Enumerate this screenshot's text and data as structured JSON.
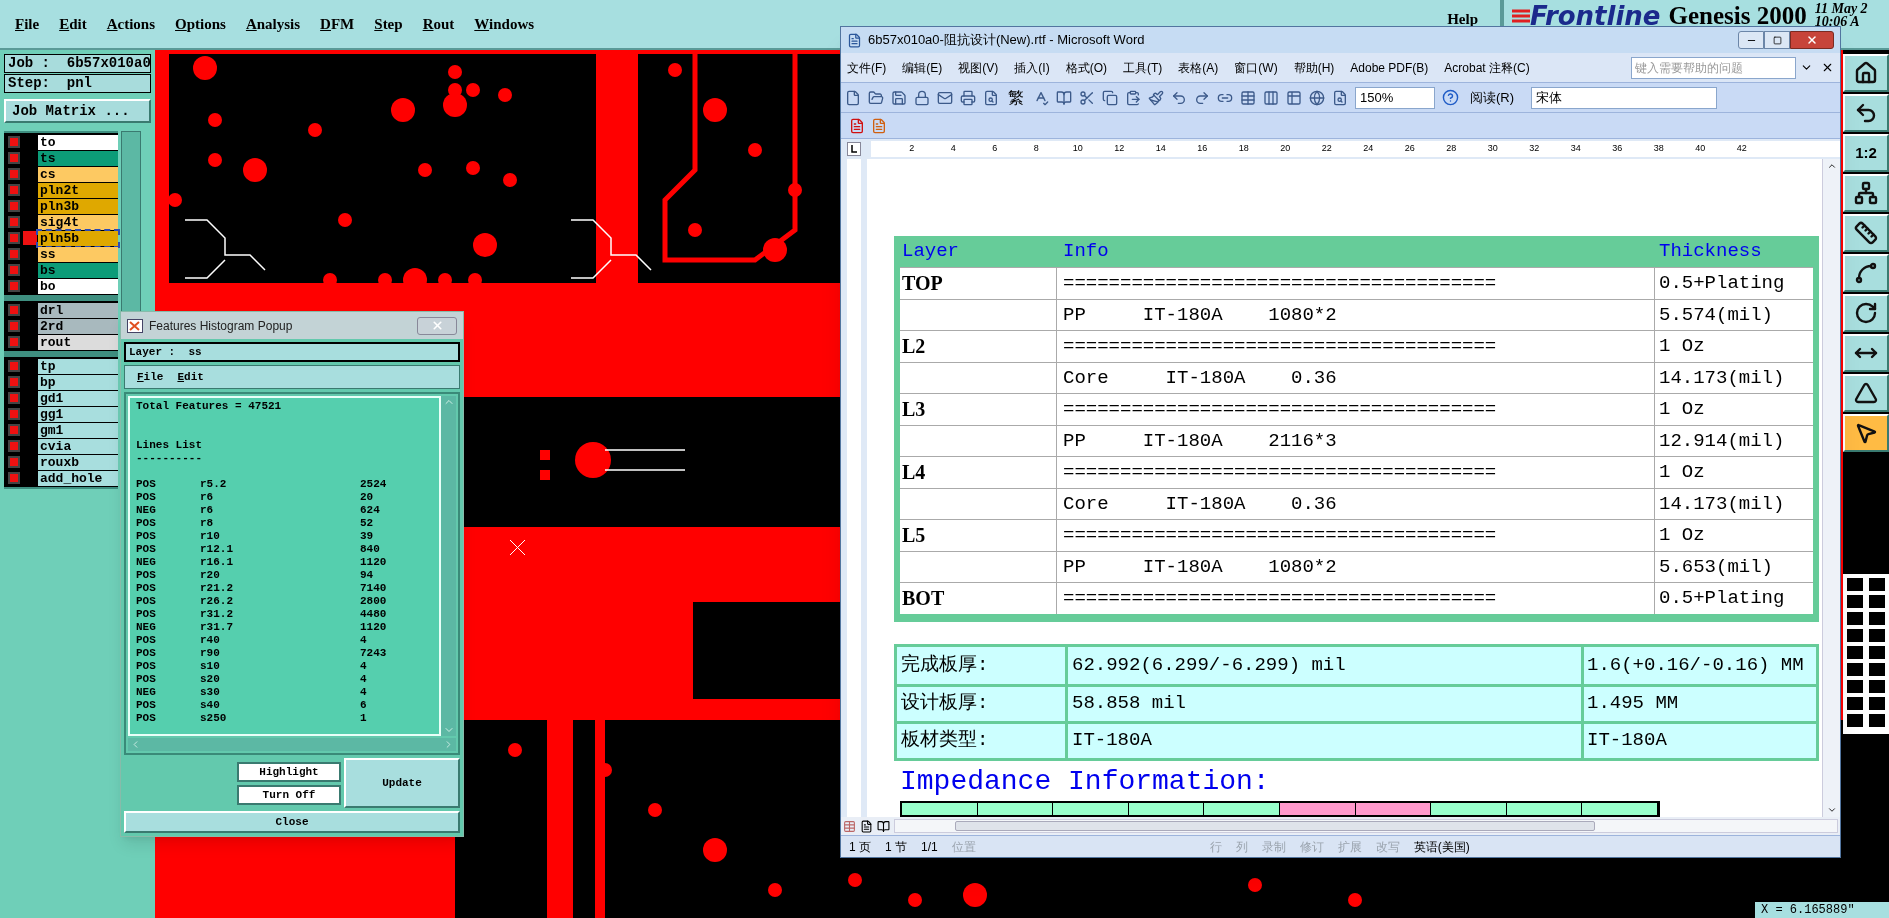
{
  "menu_bar": {
    "items": [
      "File",
      "Edit",
      "Actions",
      "Options",
      "Analysis",
      "DFM",
      "Step",
      "Rout",
      "Windows"
    ],
    "help": "Help"
  },
  "brand": {
    "logo": "Frontline",
    "product": "Genesis 2000",
    "date": "11 May 2",
    "time": "10:06 A"
  },
  "job": {
    "job": "Job :  6b57x010a0",
    "step": "Step:  pnl",
    "matrix_button": "Job Matrix ..."
  },
  "layer_groups": [
    [
      {
        "name": "to",
        "color": "#ffffff",
        "checked": true,
        "selected": false
      },
      {
        "name": "ts",
        "color": "#0c9c78",
        "checked": true,
        "selected": false
      },
      {
        "name": "cs",
        "color": "#fdc962",
        "checked": true,
        "selected": false
      },
      {
        "name": "pln2t",
        "color": "#dfa800",
        "checked": true,
        "selected": false
      },
      {
        "name": "pln3b",
        "color": "#dfa800",
        "checked": true,
        "selected": false
      },
      {
        "name": "sig4t",
        "color": "#fdc962",
        "checked": true,
        "selected": false
      },
      {
        "name": "pln5b",
        "color": "#dfa800",
        "checked": true,
        "selected": true
      },
      {
        "name": "ss",
        "color": "#fdc962",
        "checked": true,
        "selected": false
      },
      {
        "name": "bs",
        "color": "#0c9c78",
        "checked": true,
        "selected": false
      },
      {
        "name": "bo",
        "color": "#ffffff",
        "checked": true,
        "selected": false
      }
    ],
    [
      {
        "name": "drl",
        "color": "#a8b9be",
        "checked": true,
        "selected": false
      },
      {
        "name": "2rd",
        "color": "#a8b9be",
        "checked": true,
        "selected": false
      },
      {
        "name": "rout",
        "color": "#dcdcdc",
        "checked": true,
        "selected": false
      }
    ],
    [
      {
        "name": "tp",
        "color": "#a8dede",
        "checked": true,
        "selected": false
      },
      {
        "name": "bp",
        "color": "#a8dede",
        "checked": true,
        "selected": false
      },
      {
        "name": "gd1",
        "color": "#a8dede",
        "checked": true,
        "selected": false
      },
      {
        "name": "gg1",
        "color": "#a8dede",
        "checked": true,
        "selected": false
      },
      {
        "name": "gm1",
        "color": "#a8dede",
        "checked": true,
        "selected": false
      },
      {
        "name": "cvia",
        "color": "#a8dede",
        "checked": true,
        "selected": false
      },
      {
        "name": "rouxb",
        "color": "#a8dede",
        "checked": true,
        "selected": false
      },
      {
        "name": "add_hole",
        "color": "#a8dede",
        "checked": true,
        "selected": false
      }
    ]
  ],
  "tool_buttons": [
    {
      "kind": "home",
      "selected": false
    },
    {
      "kind": "undo",
      "selected": false
    },
    {
      "kind": "text",
      "label": "1:2",
      "selected": false
    },
    {
      "kind": "network",
      "selected": false
    },
    {
      "kind": "ruler",
      "selected": false
    },
    {
      "kind": "line",
      "selected": false
    },
    {
      "kind": "rotate",
      "selected": false
    },
    {
      "kind": "arrows",
      "selected": false
    },
    {
      "kind": "triangle",
      "selected": false
    },
    {
      "kind": "pointer",
      "selected": true
    }
  ],
  "coordinates": "X = 6.165889\"",
  "histogram": {
    "title": "Features Histogram Popup",
    "layer": "Layer :  ss",
    "menu": [
      "File",
      "Edit"
    ],
    "total": "Total Features = 47521",
    "list_title": "Lines List",
    "separator": "----------",
    "rows": [
      {
        "polarity": "POS",
        "symbol": "r5.2",
        "count": "2524"
      },
      {
        "polarity": "POS",
        "symbol": "r6",
        "count": "20"
      },
      {
        "polarity": "NEG",
        "symbol": "r6",
        "count": "624"
      },
      {
        "polarity": "POS",
        "symbol": "r8",
        "count": "52"
      },
      {
        "polarity": "POS",
        "symbol": "r10",
        "count": "39"
      },
      {
        "polarity": "POS",
        "symbol": "r12.1",
        "count": "840"
      },
      {
        "polarity": "NEG",
        "symbol": "r16.1",
        "count": "1120"
      },
      {
        "polarity": "POS",
        "symbol": "r20",
        "count": "94"
      },
      {
        "polarity": "POS",
        "symbol": "r21.2",
        "count": "7140"
      },
      {
        "polarity": "POS",
        "symbol": "r26.2",
        "count": "2800"
      },
      {
        "polarity": "POS",
        "symbol": "r31.2",
        "count": "4480"
      },
      {
        "polarity": "NEG",
        "symbol": "r31.7",
        "count": "1120"
      },
      {
        "polarity": "POS",
        "symbol": "r40",
        "count": "4"
      },
      {
        "polarity": "POS",
        "symbol": "r90",
        "count": "7243"
      },
      {
        "polarity": "POS",
        "symbol": "s10",
        "count": "4"
      },
      {
        "polarity": "POS",
        "symbol": "s20",
        "count": "4"
      },
      {
        "polarity": "NEG",
        "symbol": "s30",
        "count": "4"
      },
      {
        "polarity": "POS",
        "symbol": "s40",
        "count": "6"
      },
      {
        "polarity": "POS",
        "symbol": "s250",
        "count": "1"
      }
    ],
    "buttons": {
      "highlight": "Highlight",
      "turn_off": "Turn Off",
      "update": "Update",
      "close": "Close"
    }
  },
  "word": {
    "title": "6b57x010a0-阻抗设计(New).rtf - Microsoft Word",
    "menu": [
      "文件(F)",
      "编辑(E)",
      "视图(V)",
      "插入(I)",
      "格式(O)",
      "工具(T)",
      "表格(A)",
      "窗口(W)",
      "帮助(H)",
      "Adobe PDF(B)",
      "Acrobat 注释(C)"
    ],
    "help_placeholder": "键入需要帮助的问题",
    "toolbar": {
      "traditional": "繁",
      "zoom": "150%",
      "read": "阅读(R)",
      "font": "宋体"
    },
    "ruler": [
      "2",
      "4",
      "6",
      "8",
      "10",
      "12",
      "14",
      "16",
      "18",
      "20",
      "22",
      "24",
      "26",
      "28",
      "30",
      "32",
      "34",
      "36",
      "38",
      "40",
      "42"
    ],
    "stackup": {
      "columns": [
        "Layer",
        "Info",
        "Thickness"
      ],
      "rows": [
        {
          "layer": "TOP",
          "info": "======================================",
          "thickness": "0.5+Plating"
        },
        {
          "info": "PP     IT-180A    1080*2",
          "thickness": "5.574(mil)"
        },
        {
          "layer": "L2",
          "info": "======================================",
          "thickness": "1 Oz"
        },
        {
          "info": "Core     IT-180A    0.36",
          "thickness": "14.173(mil)"
        },
        {
          "layer": "L3",
          "info": "======================================",
          "thickness": "1 Oz"
        },
        {
          "info": "PP     IT-180A    2116*3",
          "thickness": "12.914(mil)"
        },
        {
          "layer": "L4",
          "info": "======================================",
          "thickness": "1 Oz"
        },
        {
          "info": "Core     IT-180A    0.36",
          "thickness": "14.173(mil)"
        },
        {
          "layer": "L5",
          "info": "======================================",
          "thickness": "1 Oz"
        },
        {
          "info": "PP     IT-180A    1080*2",
          "thickness": "5.653(mil)"
        },
        {
          "layer": "BOT",
          "info": "======================================",
          "thickness": "0.5+Plating"
        }
      ]
    },
    "summary": [
      {
        "label": "完成板厚:",
        "value": "62.992(6.299/-6.299) mil",
        "metric": "1.6(+0.16/-0.16) MM"
      },
      {
        "label": "设计板厚:",
        "value": "58.858 mil",
        "metric": "1.495 MM"
      },
      {
        "label": "板材类型:",
        "value": "IT-180A",
        "metric": "IT-180A"
      }
    ],
    "heading": "Impedance Information:",
    "impedance_columns": [
      {
        "color": "#99ffcc"
      },
      {
        "color": "#99ffcc"
      },
      {
        "color": "#99ffcc"
      },
      {
        "color": "#99ffcc"
      },
      {
        "color": "#99ffcc"
      },
      {
        "color": "#ff99cc"
      },
      {
        "color": "#ff99cc"
      },
      {
        "color": "#99ffcc"
      },
      {
        "color": "#99ffcc"
      },
      {
        "color": "#99ffcc"
      }
    ],
    "status": [
      {
        "text": "1 页",
        "disabled": false
      },
      {
        "text": "1 节",
        "disabled": false
      },
      {
        "text": "1/1",
        "disabled": false
      },
      {
        "text": "位置",
        "disabled": true
      },
      {
        "text": "行",
        "disabled": true
      },
      {
        "text": "列",
        "disabled": true
      },
      {
        "text": "录制",
        "disabled": true
      },
      {
        "text": "修订",
        "disabled": true
      },
      {
        "text": "扩展",
        "disabled": true
      },
      {
        "text": "改写",
        "disabled": true
      },
      {
        "text": "英语(美国)",
        "disabled": false
      }
    ]
  }
}
